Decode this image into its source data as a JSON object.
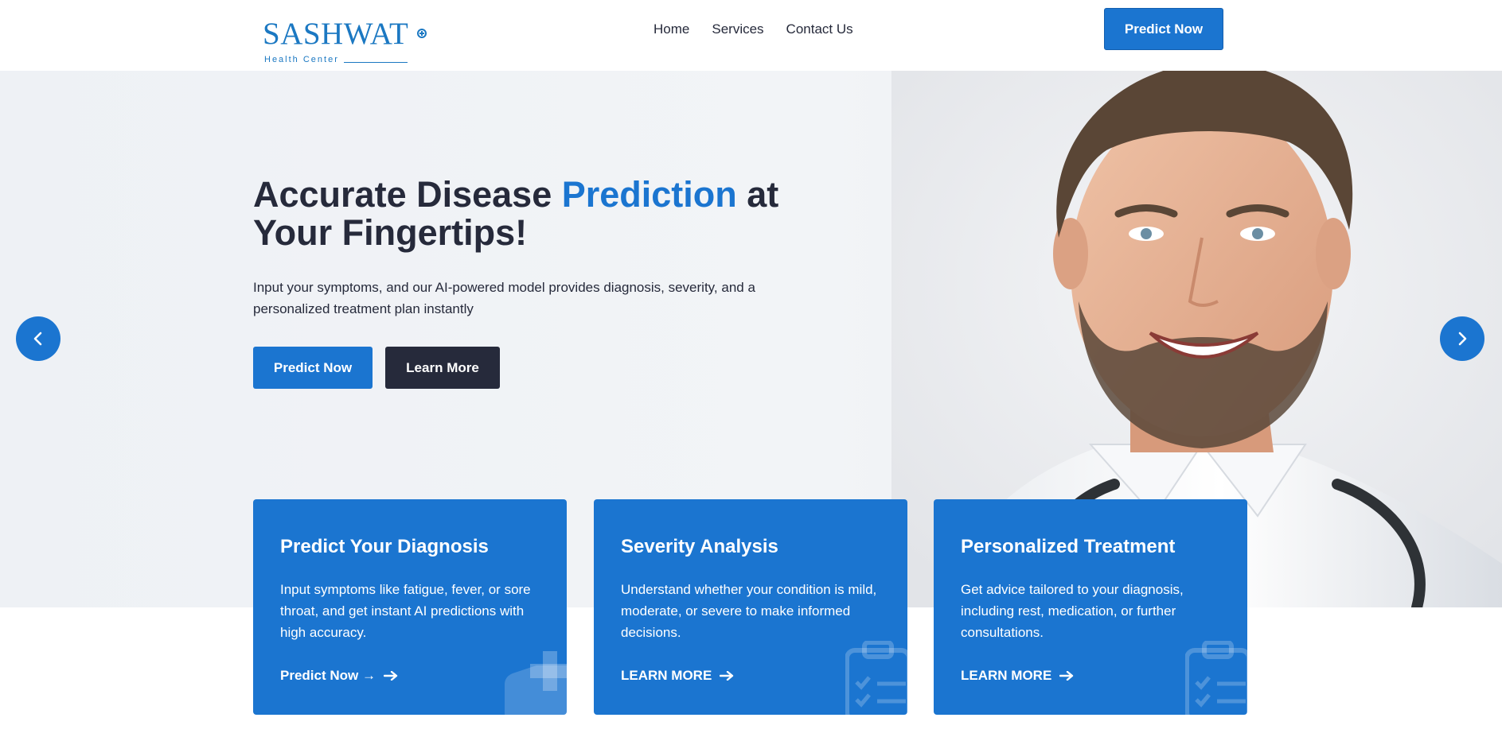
{
  "header": {
    "logo_main": "SASHWAT",
    "logo_sub": "Health Center",
    "nav": [
      "Home",
      "Services",
      "Contact Us"
    ],
    "cta_label": "Predict Now"
  },
  "hero": {
    "title_part1": "Accurate Disease ",
    "title_accent": "Prediction",
    "title_part2": " at Your Fingertips!",
    "description": "Input your symptoms, and our AI-powered model provides diagnosis, severity, and a personalized treatment plan instantly",
    "primary_button": "Predict Now",
    "secondary_button": "Learn More"
  },
  "cards": [
    {
      "title": "Predict Your Diagnosis",
      "text": "Input symptoms like fatigue, fever, or sore throat, and get instant AI predictions with high accuracy.",
      "link": "Predict Now →",
      "icon": "ambulance-icon"
    },
    {
      "title": "Severity Analysis",
      "text": "Understand whether your condition is mild, moderate, or severe to make informed decisions.",
      "link": "LEARN MORE",
      "icon": "clipboard-check-icon"
    },
    {
      "title": "Personalized Treatment",
      "text": "Get advice tailored to your diagnosis, including rest, medication, or further consultations.",
      "link": "LEARN MORE",
      "icon": "clipboard-check-icon"
    }
  ],
  "colors": {
    "brand_blue": "#1b75d0",
    "dark": "#262a3b",
    "hero_bg": "#eef1f5"
  }
}
